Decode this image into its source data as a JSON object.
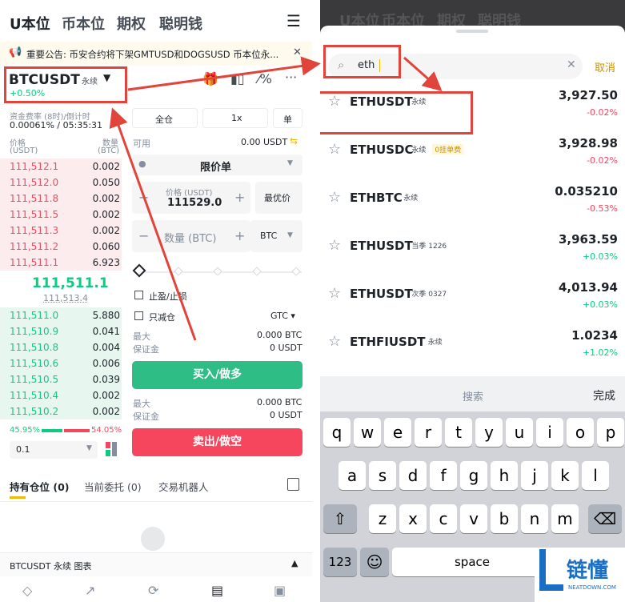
{
  "left": {
    "tabs": [
      "U本位",
      "币本位",
      "期权",
      "聪明钱"
    ],
    "announcement": "重要公告: 币安合约将下架GMTUSD和DOGSUSD 币本位永...",
    "symbol": "BTCUSDT",
    "symbol_tag": "永续",
    "change": "+0.50%",
    "funding_label": "资金费率 (8时)/倒计时",
    "funding_value": "0.00061% / 05:35:31",
    "price_head": "价格",
    "price_unit": "(USDT)",
    "qty_head": "数量",
    "qty_unit": "(BTC)",
    "asks": [
      [
        "111,512.1",
        "0.002"
      ],
      [
        "111,512.0",
        "0.050"
      ],
      [
        "111,511.8",
        "0.002"
      ],
      [
        "111,511.5",
        "0.002"
      ],
      [
        "111,511.3",
        "0.002"
      ],
      [
        "111,511.2",
        "0.060"
      ],
      [
        "111,511.1",
        "6.923"
      ]
    ],
    "last_price": "111,511.1",
    "mark_price": "111,513.4",
    "bids": [
      [
        "111,511.0",
        "5.880"
      ],
      [
        "111,510.9",
        "0.041"
      ],
      [
        "111,510.8",
        "0.004"
      ],
      [
        "111,510.6",
        "0.006"
      ],
      [
        "111,510.5",
        "0.039"
      ],
      [
        "111,510.4",
        "0.002"
      ],
      [
        "111,510.2",
        "0.002"
      ]
    ],
    "buy_pct": "45.95%",
    "sell_pct": "54.05%",
    "depth_step": "0.1",
    "margin_mode": "全仓",
    "leverage": "1x",
    "pos_mode": "单",
    "available_label": "可用",
    "available_value": "0.00 USDT",
    "order_type": "限价单",
    "price_field_label": "价格 (USDT)",
    "price_field_value": "111529.0",
    "best_price": "最优价",
    "qty_placeholder": "数量 (BTC)",
    "qty_unit_sel": "BTC",
    "tpsl": "止盈/止损",
    "reduce_only": "只减仓",
    "tif": "GTC",
    "max_label": "最大",
    "max_value": "0.000 BTC",
    "margin_label": "保证金",
    "margin_value": "0 USDT",
    "buy_btn": "买入/做多",
    "sell_btn": "卖出/做空",
    "pos_tabs": [
      "持有仓位 (0)",
      "当前委托 (0)",
      "交易机器人"
    ],
    "chart_bar": "BTCUSDT 永续  图表",
    "colors": {
      "ask": "#f6465d",
      "bid": "#0ecb81",
      "accent": "#f0b90b",
      "annotation": "#e0443a"
    }
  },
  "right": {
    "bg_tabs": [
      "U本位",
      "币本位",
      "期权",
      "聪明钱"
    ],
    "search_value": "eth",
    "cancel": "取消",
    "results": [
      {
        "sym": "ETHUSDT",
        "tag": "永续",
        "extra": "",
        "price": "3,927.50",
        "change": "-0.02%",
        "up": false
      },
      {
        "sym": "ETHUSDC",
        "tag": "永续",
        "extra": "0挂单费",
        "price": "3,928.98",
        "change": "-0.02%",
        "up": false
      },
      {
        "sym": "ETHBTC",
        "tag": "永续",
        "extra": "",
        "price": "0.035210",
        "change": "-0.53%",
        "up": false
      },
      {
        "sym": "ETHUSDT",
        "tag": "当季 1226",
        "extra": "",
        "price": "3,963.59",
        "change": "+0.03%",
        "up": true
      },
      {
        "sym": "ETHUSDT",
        "tag": "次季 0327",
        "extra": "",
        "price": "4,013.94",
        "change": "+0.03%",
        "up": true
      },
      {
        "sym": "ETHFIUSDT",
        "tag": "永续",
        "extra": "",
        "price": "1.0234",
        "change": "+1.02%",
        "up": true
      }
    ],
    "kb_search": "搜索",
    "kb_done": "完成",
    "row1": [
      "q",
      "w",
      "e",
      "r",
      "t",
      "y",
      "u",
      "i",
      "o",
      "p"
    ],
    "row2": [
      "a",
      "s",
      "d",
      "f",
      "g",
      "h",
      "j",
      "k",
      "l"
    ],
    "row3": [
      "z",
      "x",
      "c",
      "v",
      "b",
      "n",
      "m"
    ],
    "num_key": "123",
    "space": "space",
    "watermark_cn": "链懂",
    "watermark_en": "NEATDOWN.COM"
  }
}
